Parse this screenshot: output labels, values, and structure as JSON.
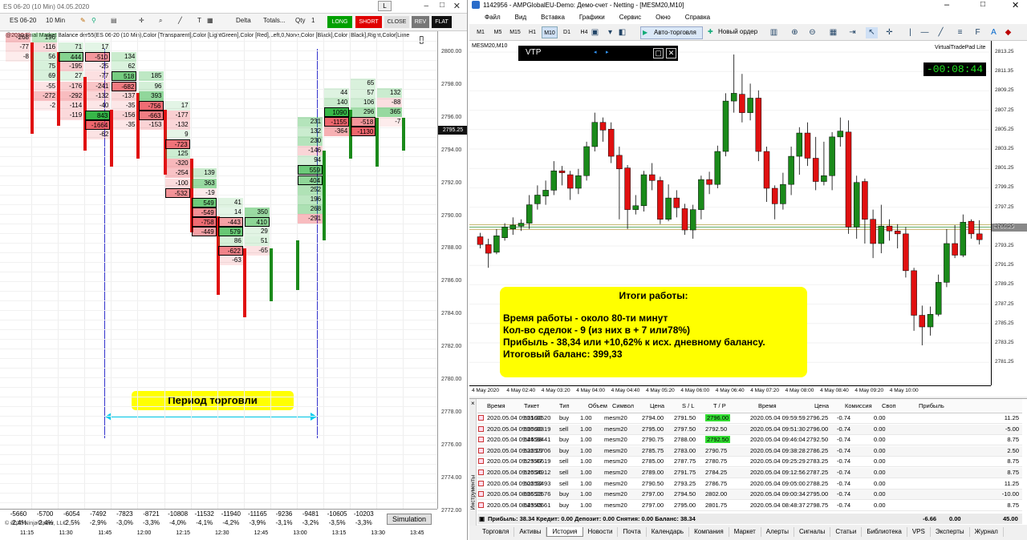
{
  "left": {
    "title": "ES 06-20 (10 Min)  04.05.2020",
    "toolbar": {
      "instrument": "ES 06-20",
      "interval": "10 Min",
      "mode": "Delta",
      "totals": "Totals...",
      "qty_label": "Qty",
      "qty": "1",
      "long": "LONG",
      "short": "SHORT",
      "close": "CLOSE",
      "rev": "REV",
      "flat": "FLAT",
      "lock": "L"
    },
    "indicator_text": "@2010 Final Market Balance  der55(ES 06-20 (10 Min),Color [Transparent],Color [LightGreen],Color [Red],Left,0,None,Color [Black],Color [Black],Right,Color[Lime",
    "price_labels": [
      "2800.00",
      "2798.00",
      "2796.00",
      "2794.00",
      "2792.00",
      "2790.00",
      "2788.00",
      "2786.00",
      "2784.00",
      "2782.00",
      "2780.00",
      "2778.00",
      "2776.00",
      "2774.00",
      "2772.00"
    ],
    "current_price": "2795.25",
    "summary_top": [
      "-5660",
      "-5700",
      "-6054",
      "-7492",
      "-7823",
      "-8721",
      "-10808",
      "-11532",
      "-11940",
      "-11165",
      "-9236",
      "-9481",
      "-10605",
      "-10203"
    ],
    "summary_bottom": [
      "-2,4%",
      "-2,4%",
      "-2,5%",
      "-2,9%",
      "-3,0%",
      "-3,3%",
      "-4,0%",
      "-4,1%",
      "-4,2%",
      "-3,9%",
      "-3,1%",
      "-3,2%",
      "-3,5%",
      "-3,3%"
    ],
    "time_labels": [
      "11:15",
      "11:30",
      "11:45",
      "12:00",
      "12:15",
      "12:30",
      "12:45",
      "13:00",
      "13:15",
      "13:30",
      "13:45"
    ],
    "copyright": "© 2020 NinjaTrader, LLC",
    "simulation": "Simulation",
    "period_label": "Период торговли"
  },
  "cells": [
    [
      "-268",
      0,
      0
    ],
    [
      "196",
      1,
      0
    ],
    [
      "-77",
      0,
      1
    ],
    [
      "-116",
      1,
      1
    ],
    [
      "71",
      2,
      1
    ],
    [
      "17",
      3,
      1
    ],
    [
      "-8",
      0,
      2
    ],
    [
      "56",
      1,
      2
    ],
    [
      "444",
      2,
      2
    ],
    [
      "-510",
      3,
      2
    ],
    [
      "134",
      4,
      2
    ],
    [
      "75",
      1,
      3
    ],
    [
      "-195",
      2,
      3
    ],
    [
      "-25",
      3,
      3
    ],
    [
      "62",
      4,
      3
    ],
    [
      "69",
      1,
      4
    ],
    [
      "27",
      2,
      4
    ],
    [
      "-77",
      3,
      4
    ],
    [
      "518",
      4,
      4
    ],
    [
      "185",
      5,
      4
    ],
    [
      "-55",
      1,
      5
    ],
    [
      "-176",
      2,
      5
    ],
    [
      "-241",
      3,
      5
    ],
    [
      "-682",
      4,
      5
    ],
    [
      "96",
      5,
      5
    ],
    [
      "-272",
      1,
      6
    ],
    [
      "-292",
      2,
      6
    ],
    [
      "-132",
      3,
      6
    ],
    [
      "-137",
      4,
      6
    ],
    [
      "393",
      5,
      6
    ],
    [
      "44",
      12,
      6
    ],
    [
      "65",
      13,
      5
    ],
    [
      "-2",
      1,
      7
    ],
    [
      "-114",
      2,
      7
    ],
    [
      "-40",
      3,
      7
    ],
    [
      "-35",
      4,
      7
    ],
    [
      "-756",
      5,
      7
    ],
    [
      "17",
      6,
      7
    ],
    [
      "140",
      12,
      7
    ],
    [
      "57",
      13,
      6
    ],
    [
      "132",
      14,
      6
    ],
    [
      "-119",
      2,
      8
    ],
    [
      "843",
      3,
      8
    ],
    [
      "-156",
      4,
      8
    ],
    [
      "-663",
      5,
      8
    ],
    [
      "-177",
      6,
      8
    ],
    [
      "1090",
      12,
      8
    ],
    [
      "106",
      13,
      7
    ],
    [
      "-88",
      14,
      7
    ],
    [
      "-1664",
      3,
      9
    ],
    [
      "-35",
      4,
      9
    ],
    [
      "-153",
      5,
      9
    ],
    [
      "-132",
      6,
      9
    ],
    [
      "231",
      11,
      9
    ],
    [
      "-1155",
      12,
      9
    ],
    [
      "296",
      13,
      8
    ],
    [
      "365",
      14,
      8
    ],
    [
      "-62",
      3,
      10
    ],
    [
      "9",
      6,
      10
    ],
    [
      "132",
      11,
      10
    ],
    [
      "-364",
      12,
      10
    ],
    [
      "-518",
      13,
      9
    ],
    [
      "-7",
      14,
      9
    ],
    [
      "-723",
      6,
      11
    ],
    [
      "230",
      11,
      11
    ],
    [
      "-1130",
      13,
      10
    ],
    [
      "125",
      6,
      12
    ],
    [
      "-146",
      11,
      12
    ],
    [
      "-320",
      6,
      13
    ],
    [
      "94",
      11,
      13
    ],
    [
      "-254",
      6,
      14
    ],
    [
      "139",
      7,
      14
    ],
    [
      "559",
      11,
      14
    ],
    [
      "-100",
      6,
      15
    ],
    [
      "363",
      7,
      15
    ],
    [
      "404",
      11,
      15
    ],
    [
      "-532",
      6,
      16
    ],
    [
      "-19",
      7,
      16
    ],
    [
      "252",
      11,
      16
    ],
    [
      "549",
      7,
      17
    ],
    [
      "41",
      8,
      17
    ],
    [
      "196",
      11,
      17
    ],
    [
      "-549",
      7,
      18
    ],
    [
      "14",
      8,
      18
    ],
    [
      "350",
      9,
      18
    ],
    [
      "268",
      11,
      18
    ],
    [
      "-758",
      7,
      19
    ],
    [
      "-443",
      8,
      19
    ],
    [
      "410",
      9,
      19
    ],
    [
      "-291",
      11,
      19
    ],
    [
      "-449",
      7,
      20
    ],
    [
      "579",
      8,
      20
    ],
    [
      "29",
      9,
      20
    ],
    [
      "86",
      8,
      21
    ],
    [
      "51",
      9,
      21
    ],
    [
      "-622",
      8,
      22
    ],
    [
      "-65",
      9,
      22
    ],
    [
      "-63",
      8,
      23
    ]
  ],
  "right": {
    "title": "1142956 - AMPGlobalEU-Demo: Демо-счет - Netting - [MESM20,M10]",
    "menu": [
      "Файл",
      "Вид",
      "Вставка",
      "Графики",
      "Сервис",
      "Окно",
      "Справка"
    ],
    "timeframes": [
      "M1",
      "M5",
      "M15",
      "H1",
      "M10",
      "D1",
      "H4"
    ],
    "autotrade": "Авто-торговля",
    "new_order": "Новый ордер",
    "symbol_label": "MESM20,M10",
    "vtp_title": "VTP",
    "vtp_brand": "VirtualTradePad Lite",
    "timer": "-00:08:44",
    "price_labels": [
      "2813.25",
      "2811.35",
      "2809.25",
      "2807.25",
      "2805.25",
      "2803.25",
      "2801.25",
      "2799.25",
      "2797.25",
      "2795.25",
      "2793.25",
      "2791.25",
      "2789.25",
      "2787.25",
      "2785.25",
      "2783.25",
      "2781.25"
    ],
    "current_price": "2795.25",
    "time_labels": [
      "4 May 2020",
      "4 May 02:40",
      "4 May 03:20",
      "4 May 04:00",
      "4 May 04:40",
      "4 May 05:20",
      "4 May 06:00",
      "4 May 06:40",
      "4 May 07:20",
      "4 May 08:00",
      "4 May 08:40",
      "4 May 09:20",
      "4 May 10:00"
    ],
    "results": {
      "heading": "Итоги работы:",
      "lines": [
        "Время работы - около 80-ти минут",
        "Кол-во сделок - 9 (из них в + 7 или78%)",
        "Прибыль - 38,34 или +10,62% к исх. дневному балансу.",
        "Итоговый баланс: 399,33"
      ]
    },
    "table": {
      "headers": [
        "Время",
        "Тикет",
        "Тип",
        "Объем",
        "Символ",
        "Цена",
        "S / L",
        "T / P",
        "Время",
        "Цена",
        "Комиссия",
        "Своп",
        "Прибыль"
      ],
      "rows": [
        [
          "2020.05.04 09:51:30",
          "52560520",
          "buy",
          "1.00",
          "mesm20",
          "2794.00",
          "2791.50",
          "2796.00",
          "2020.05.04 09:59:59",
          "2796.25",
          "-0.74",
          "0.00",
          "11.25"
        ],
        [
          "2020.05.04 09:50:30",
          "52560319",
          "sell",
          "1.00",
          "mesm20",
          "2795.00",
          "2797.50",
          "2792.50",
          "2020.05.04 09:51:30",
          "2796.00",
          "-0.74",
          "0.00",
          "-5.00"
        ],
        [
          "2020.05.04 09:44:38",
          "52559441",
          "buy",
          "1.00",
          "mesm20",
          "2790.75",
          "2788.00",
          "2792.50",
          "2020.05.04 09:46:04",
          "2792.50",
          "-0.74",
          "0.00",
          "8.75"
        ],
        [
          "2020.05.04 09:32:19",
          "52557706",
          "buy",
          "1.00",
          "mesm20",
          "2785.75",
          "2783.00",
          "2790.75",
          "2020.05.04 09:38:28",
          "2786.25",
          "-0.74",
          "0.00",
          "2.50"
        ],
        [
          "2020.05.04 09:23:47",
          "52556619",
          "sell",
          "1.00",
          "mesm20",
          "2785.00",
          "2787.75",
          "2780.75",
          "2020.05.04 09:25:29",
          "2783.25",
          "-0.74",
          "0.00",
          "8.75"
        ],
        [
          "2020.05.04 09:10:26",
          "52554912",
          "sell",
          "1.00",
          "mesm20",
          "2789.00",
          "2791.75",
          "2784.25",
          "2020.05.04 09:12:56",
          "2787.25",
          "-0.74",
          "0.00",
          "8.75"
        ],
        [
          "2020.05.04 09:02:52",
          "52553493",
          "sell",
          "1.00",
          "mesm20",
          "2790.50",
          "2793.25",
          "2786.75",
          "2020.05.04 09:05:00",
          "2788.25",
          "-0.74",
          "0.00",
          "11.25"
        ],
        [
          "2020.05.04 08:56:23",
          "52552576",
          "buy",
          "1.00",
          "mesm20",
          "2797.00",
          "2794.50",
          "2802.00",
          "2020.05.04 09:00:34",
          "2795.00",
          "-0.74",
          "0.00",
          "-10.00"
        ],
        [
          "2020.05.04 08:43:45",
          "52550661",
          "buy",
          "1.00",
          "mesm20",
          "2797.00",
          "2795.00",
          "2801.75",
          "2020.05.04 08:48:37",
          "2798.75",
          "-0.74",
          "0.00",
          "8.75"
        ]
      ],
      "tp_highlight": [
        0,
        2
      ],
      "totals": "Прибыль: 38.34  Кредит: 0.00  Депозит: 0.00  Снятия: 0.00  Баланс: 38.34",
      "total_commission": "-6.66",
      "total_swap": "0.00",
      "total_profit": "45.00"
    },
    "side_label": "Инструменты",
    "bottom_tabs": [
      "Торговля",
      "Активы",
      "История",
      "Новости",
      "Почта",
      "Календарь",
      "Компания",
      "Маркет",
      "Алерты",
      "Сигналы",
      "Статьи",
      "Библиотека",
      "VPS",
      "Эксперты",
      "Журнал"
    ],
    "active_tab": "История"
  },
  "colors": {
    "long": "#00a000",
    "short": "#e00000",
    "bull": "#1a8a1a",
    "bear": "#e01010",
    "blue_line": "#3333cc",
    "cyan_arrow": "#00ccee",
    "yellow": "#ffff00",
    "sim": "#e0e0e0"
  },
  "candles_left": [
    [
      0,
      2800.6,
      2795.0
    ],
    [
      1,
      2800.0,
      2795.5
    ],
    [
      2,
      2798.5,
      2794.0
    ],
    [
      3,
      2796.5,
      2793.0
    ],
    [
      4,
      2797.5,
      2793.5
    ],
    [
      5,
      2796.5,
      2792.5
    ],
    [
      6,
      2793.5,
      2789.0
    ],
    [
      7,
      2790.0,
      2785.2
    ],
    [
      8,
      2788.0,
      2783.8
    ],
    [
      9,
      2788.0,
      2784.8
    ],
    [
      10,
      2788.5,
      2785.5
    ],
    [
      11,
      2794.0,
      2788.5
    ],
    [
      12,
      2796.5,
      2793.5
    ],
    [
      13,
      2796.0,
      2793.0
    ],
    [
      14,
      2796.0,
      2794.0
    ]
  ],
  "candles_right": [
    [
      2794.2,
      2793.4,
      2794.6,
      2793.0
    ],
    [
      2793.4,
      2792.5,
      2794.0,
      2791.0
    ],
    [
      2792.6,
      2794.3,
      2795.0,
      2792.4
    ],
    [
      2794.1,
      2795.2,
      2795.6,
      2793.8
    ],
    [
      2795.0,
      2795.4,
      2796.2,
      2794.4
    ],
    [
      2795.3,
      2795.6,
      2796.0,
      2794.8
    ],
    [
      2795.6,
      2797.5,
      2798.5,
      2795.0
    ],
    [
      2797.6,
      2798.5,
      2799.5,
      2797.0
    ],
    [
      2798.4,
      2799.0,
      2800.0,
      2797.5
    ],
    [
      2799.0,
      2801.0,
      2802.0,
      2798.5
    ],
    [
      2801.0,
      2800.8,
      2801.5,
      2799.5
    ],
    [
      2800.6,
      2799.2,
      2801.0,
      2798.0
    ],
    [
      2799.2,
      2800.5,
      2801.2,
      2798.6
    ],
    [
      2800.5,
      2803.5,
      2804.0,
      2800.0
    ],
    [
      2803.5,
      2806.0,
      2807.0,
      2803.0
    ],
    [
      2806.0,
      2805.2,
      2806.5,
      2804.0
    ],
    [
      2805.3,
      2802.5,
      2806.0,
      2801.8
    ],
    [
      2802.6,
      2801.2,
      2803.5,
      2796.0
    ],
    [
      2801.3,
      2797.0,
      2801.6,
      2795.0
    ],
    [
      2797.0,
      2797.4,
      2798.5,
      2796.5
    ],
    [
      2797.4,
      2800.6,
      2801.0,
      2796.8
    ],
    [
      2800.6,
      2800.0,
      2801.8,
      2799.0
    ],
    [
      2800.0,
      2796.0,
      2800.4,
      2795.5
    ],
    [
      2796.0,
      2798.2,
      2799.6,
      2795.8
    ],
    [
      2798.2,
      2797.2,
      2799.0,
      2796.2
    ],
    [
      2797.1,
      2794.9,
      2797.6,
      2794.4
    ],
    [
      2794.9,
      2797.0,
      2797.5,
      2794.0
    ],
    [
      2797.0,
      2800.1,
      2800.5,
      2796.0
    ],
    [
      2800.1,
      2799.6,
      2800.9,
      2798.6
    ],
    [
      2799.6,
      2803.0,
      2803.6,
      2799.2
    ],
    [
      2803.0,
      2808.2,
      2809.0,
      2802.5
    ],
    [
      2808.2,
      2809.0,
      2813.0,
      2807.0
    ],
    [
      2808.9,
      2807.0,
      2811.0,
      2806.0
    ],
    [
      2807.0,
      2808.5,
      2810.0,
      2806.2
    ],
    [
      2808.5,
      2803.0,
      2809.3,
      2802.0
    ],
    [
      2803.0,
      2799.2,
      2803.5,
      2797.8
    ],
    [
      2799.2,
      2797.6,
      2799.5,
      2796.0
    ],
    [
      2797.6,
      2799.6,
      2800.8,
      2797.0
    ],
    [
      2799.6,
      2802.5,
      2803.5,
      2798.5
    ],
    [
      2802.5,
      2804.9,
      2805.5,
      2800.6
    ],
    [
      2804.9,
      2802.3,
      2806.0,
      2801.5
    ],
    [
      2802.3,
      2799.9,
      2804.5,
      2799.0
    ],
    [
      2799.9,
      2800.5,
      2804.0,
      2799.5
    ],
    [
      2800.5,
      2804.5,
      2805.0,
      2799.0
    ],
    [
      2804.5,
      2805.1,
      2806.5,
      2803.5
    ],
    [
      2805.0,
      2795.2,
      2806.2,
      2794.5
    ],
    [
      2795.2,
      2799.8,
      2800.5,
      2794.0
    ],
    [
      2799.9,
      2796.0,
      2800.2,
      2793.5
    ],
    [
      2796.0,
      2793.5,
      2797.0,
      2792.0
    ],
    [
      2793.5,
      2795.3,
      2797.5,
      2792.5
    ],
    [
      2795.3,
      2794.8,
      2796.0,
      2793.8
    ],
    [
      2794.8,
      2794.5,
      2795.5,
      2793.0
    ],
    [
      2794.5,
      2790.7,
      2795.2,
      2790.0
    ],
    [
      2790.7,
      2786.1,
      2791.0,
      2784.5
    ],
    [
      2786.1,
      2784.9,
      2787.1,
      2783.0
    ],
    [
      2784.9,
      2786.2,
      2787.0,
      2784.0
    ],
    [
      2786.2,
      2789.5,
      2790.3,
      2786.0
    ],
    [
      2789.5,
      2793.5,
      2795.0,
      2789.0
    ],
    [
      2793.5,
      2792.3,
      2795.4,
      2792.0
    ],
    [
      2792.3,
      2795.7,
      2796.5,
      2792.1
    ],
    [
      2795.8,
      2794.5,
      2796.0,
      2794.0
    ],
    [
      2794.5,
      2793.9,
      2795.9,
      2793.4
    ]
  ]
}
